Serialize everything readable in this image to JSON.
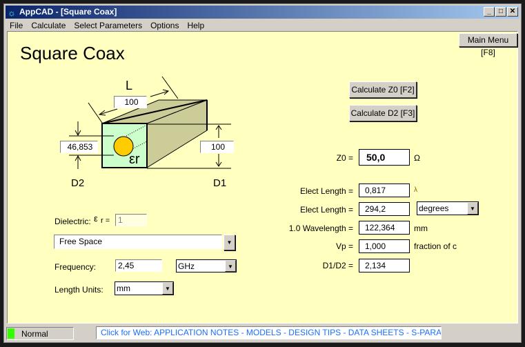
{
  "window": {
    "app_icon": "appcad-icon",
    "title": "AppCAD - [Square Coax]",
    "controls": [
      "minimize",
      "maximize",
      "close"
    ]
  },
  "menu": [
    "File",
    "Calculate",
    "Select Parameters",
    "Options",
    "Help"
  ],
  "main_menu_button": "Main Menu [F8]",
  "page_title": "Square Coax",
  "diagram": {
    "L_label": "L",
    "L_value": "100",
    "D2_label": "D2",
    "D2_value": "46,853",
    "D1_label": "D1",
    "D1_value": "100",
    "er_label": "εr",
    "colors": {
      "dielectric": "#ccffcc",
      "conductor": "#cccc99",
      "center": "#ffcc00"
    }
  },
  "buttons": {
    "calc_z0": "Calculate Z0  [F2]",
    "calc_d2": "Calculate D2  [F3]"
  },
  "results": {
    "z0_label": "Z0 =",
    "z0_value": "50,0",
    "z0_unit": "Ω",
    "elect_len_label": "Elect Length =",
    "elect_len_value": "0,817",
    "elect_len_unit": "λ",
    "elect_len2_label": "Elect Length =",
    "elect_len2_value": "294,2",
    "elect_len2_unit": "degrees",
    "wavelength_label": "1.0 Wavelength =",
    "wavelength_value": "122,364",
    "wavelength_unit": "mm",
    "vp_label": "Vp =",
    "vp_value": "1,000",
    "vp_unit": "fraction of c",
    "ratio_label": "D1/D2 =",
    "ratio_value": "2,134"
  },
  "inputs": {
    "dielectric_label": "Dielectric:",
    "er_symbol": "ε",
    "er_suffix": "r =",
    "er_value": "1",
    "dielectric_material": "Free Space",
    "frequency_label": "Frequency:",
    "frequency_value": "2,45",
    "frequency_unit": "GHz",
    "length_units_label": "Length Units:",
    "length_units_value": "mm"
  },
  "status": {
    "mode": "Normal",
    "mode_color": "#33ff00",
    "web_link": "Click for Web: APPLICATION NOTES - MODELS - DESIGN TIPS - DATA SHEETS - S-PARAMETERS"
  }
}
